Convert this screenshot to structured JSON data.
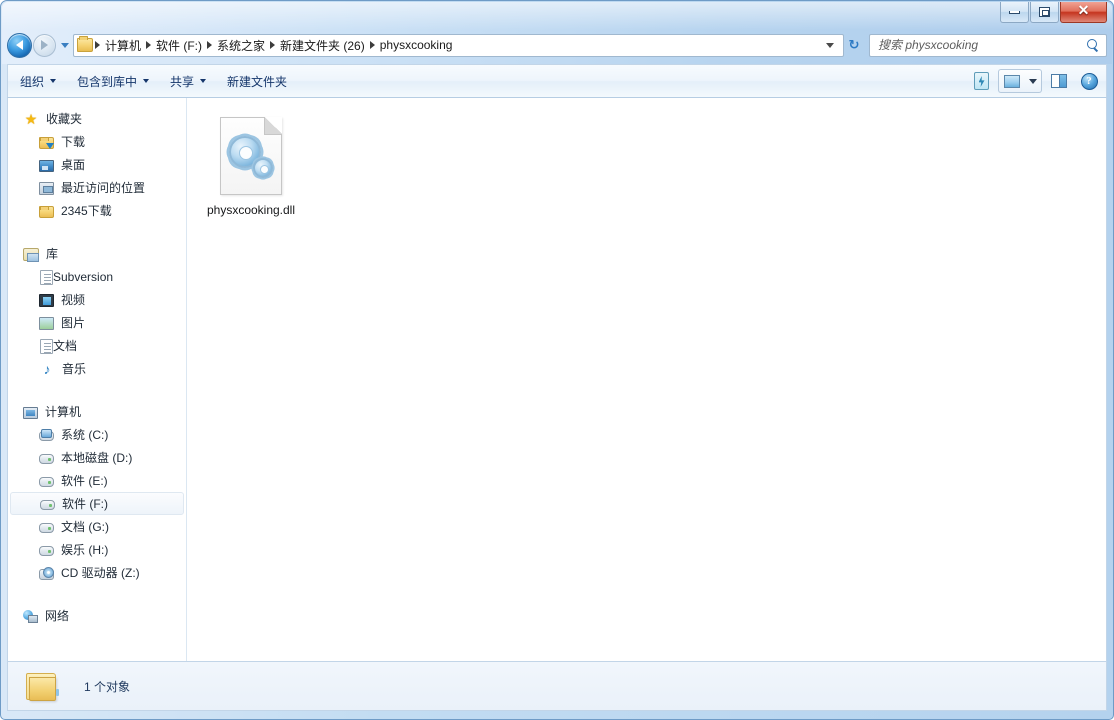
{
  "window": {
    "controls": {
      "minimize": "minimize",
      "maximize": "restore",
      "close": "✕"
    }
  },
  "address_bar": {
    "back_tooltip": "后退",
    "forward_tooltip": "前进",
    "folder_icon": "folder-icon",
    "breadcrumbs": [
      "计算机",
      "软件 (F:)",
      "系统之家",
      "新建文件夹 (26)",
      "physxcooking"
    ],
    "refresh_glyph": "↻"
  },
  "search": {
    "placeholder": "搜索 physxcooking",
    "value": ""
  },
  "command_bar": {
    "items": [
      {
        "label": "组织",
        "has_caret": true
      },
      {
        "label": "包含到库中",
        "has_caret": true
      },
      {
        "label": "共享",
        "has_caret": true
      },
      {
        "label": "新建文件夹",
        "has_caret": false
      }
    ],
    "right_icons": [
      "organize-tool-icon",
      "change-view-icon",
      "view-dropdown-caret-icon",
      "preview-pane-icon",
      "help-icon"
    ],
    "help_glyph": "?"
  },
  "sidebar": {
    "groups": [
      {
        "header": {
          "label": "收藏夹",
          "icon": "star-icon"
        },
        "items": [
          {
            "label": "下载",
            "icon": "downloads-folder-icon"
          },
          {
            "label": "桌面",
            "icon": "desktop-icon"
          },
          {
            "label": "最近访问的位置",
            "icon": "recent-places-icon"
          },
          {
            "label": "2345下载",
            "icon": "folder-icon"
          }
        ]
      },
      {
        "header": {
          "label": "库",
          "icon": "library-icon"
        },
        "items": [
          {
            "label": "Subversion",
            "icon": "document-icon"
          },
          {
            "label": "视频",
            "icon": "video-icon"
          },
          {
            "label": "图片",
            "icon": "pictures-icon"
          },
          {
            "label": "文档",
            "icon": "documents-icon"
          },
          {
            "label": "音乐",
            "icon": "music-icon"
          }
        ]
      },
      {
        "header": {
          "label": "计算机",
          "icon": "computer-icon"
        },
        "items": [
          {
            "label": "系统 (C:)",
            "icon": "system-drive-icon",
            "selected": false
          },
          {
            "label": "本地磁盘 (D:)",
            "icon": "drive-icon",
            "selected": false
          },
          {
            "label": "软件 (E:)",
            "icon": "drive-icon",
            "selected": false
          },
          {
            "label": "软件 (F:)",
            "icon": "drive-icon",
            "selected": true
          },
          {
            "label": "文档 (G:)",
            "icon": "drive-icon",
            "selected": false
          },
          {
            "label": "娱乐 (H:)",
            "icon": "drive-icon",
            "selected": false
          },
          {
            "label": "CD 驱动器 (Z:)",
            "icon": "cd-drive-icon",
            "selected": false
          }
        ]
      },
      {
        "header": {
          "label": "网络",
          "icon": "network-icon"
        },
        "items": []
      }
    ]
  },
  "content": {
    "files": [
      {
        "name": "physxcooking.dll",
        "icon": "dll-file-icon",
        "selected": false
      }
    ]
  },
  "status_bar": {
    "icon": "folder-icon",
    "text": "1 个对象"
  },
  "colors": {
    "frame": "#b4d2ee",
    "accent": "#2f6fae",
    "close_button": "#c5341f",
    "selection": "#eef4fa",
    "folder_yellow": "#f2d071"
  }
}
